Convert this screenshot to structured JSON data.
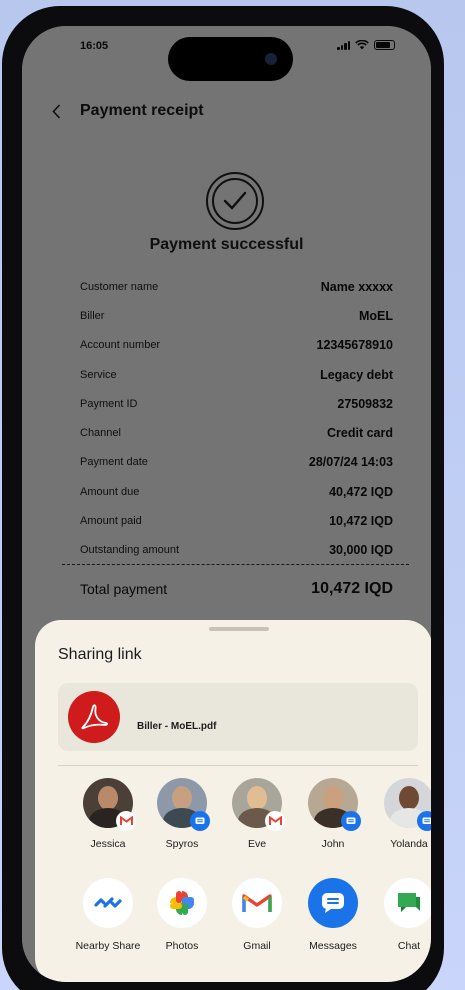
{
  "status_bar": {
    "time": "16:05"
  },
  "header": {
    "title": "Payment receipt"
  },
  "receipt": {
    "success_title": "Payment successful",
    "rows": [
      {
        "label": "Customer name",
        "value": "Name xxxxx"
      },
      {
        "label": "Biller",
        "value": "MoEL"
      },
      {
        "label": "Account number",
        "value": "12345678910"
      },
      {
        "label": "Service",
        "value": "Legacy debt"
      },
      {
        "label": "Payment ID",
        "value": "27509832"
      },
      {
        "label": "Channel",
        "value": "Credit card"
      },
      {
        "label": "Payment date",
        "value": "28/07/24 14:03"
      },
      {
        "label": "Amount due",
        "value": "40,472 IQD"
      },
      {
        "label": "Amount paid",
        "value": "10,472 IQD"
      },
      {
        "label": "Outstanding amount",
        "value": "30,000 IQD"
      }
    ],
    "total": {
      "label": "Total payment",
      "value": "10,472 IQD"
    }
  },
  "share_sheet": {
    "title": "Sharing link",
    "file_name": "Biller - MoEL.pdf",
    "contacts": [
      {
        "name": "Jessica",
        "badge": "gmail-icon"
      },
      {
        "name": "Spyros",
        "badge": "messages-icon"
      },
      {
        "name": "Eve",
        "badge": "gmail-icon"
      },
      {
        "name": "John",
        "badge": "messages-icon"
      },
      {
        "name": "Yolanda",
        "badge": "messages-icon"
      }
    ],
    "apps": [
      {
        "name": "Nearby Share",
        "icon": "nearby-share-icon"
      },
      {
        "name": "Photos",
        "icon": "photos-icon"
      },
      {
        "name": "Gmail",
        "icon": "gmail-icon"
      },
      {
        "name": "Messages",
        "icon": "messages-icon"
      },
      {
        "name": "Chat",
        "icon": "chat-icon"
      }
    ]
  },
  "colors": {
    "overlay": "#000000",
    "sheet_background": "#f5f1e6",
    "file_card": "#e9e6dc",
    "pdf_red": "#cf1b1b",
    "messages_blue": "#1a73e8",
    "chat_green": "#34a853"
  }
}
